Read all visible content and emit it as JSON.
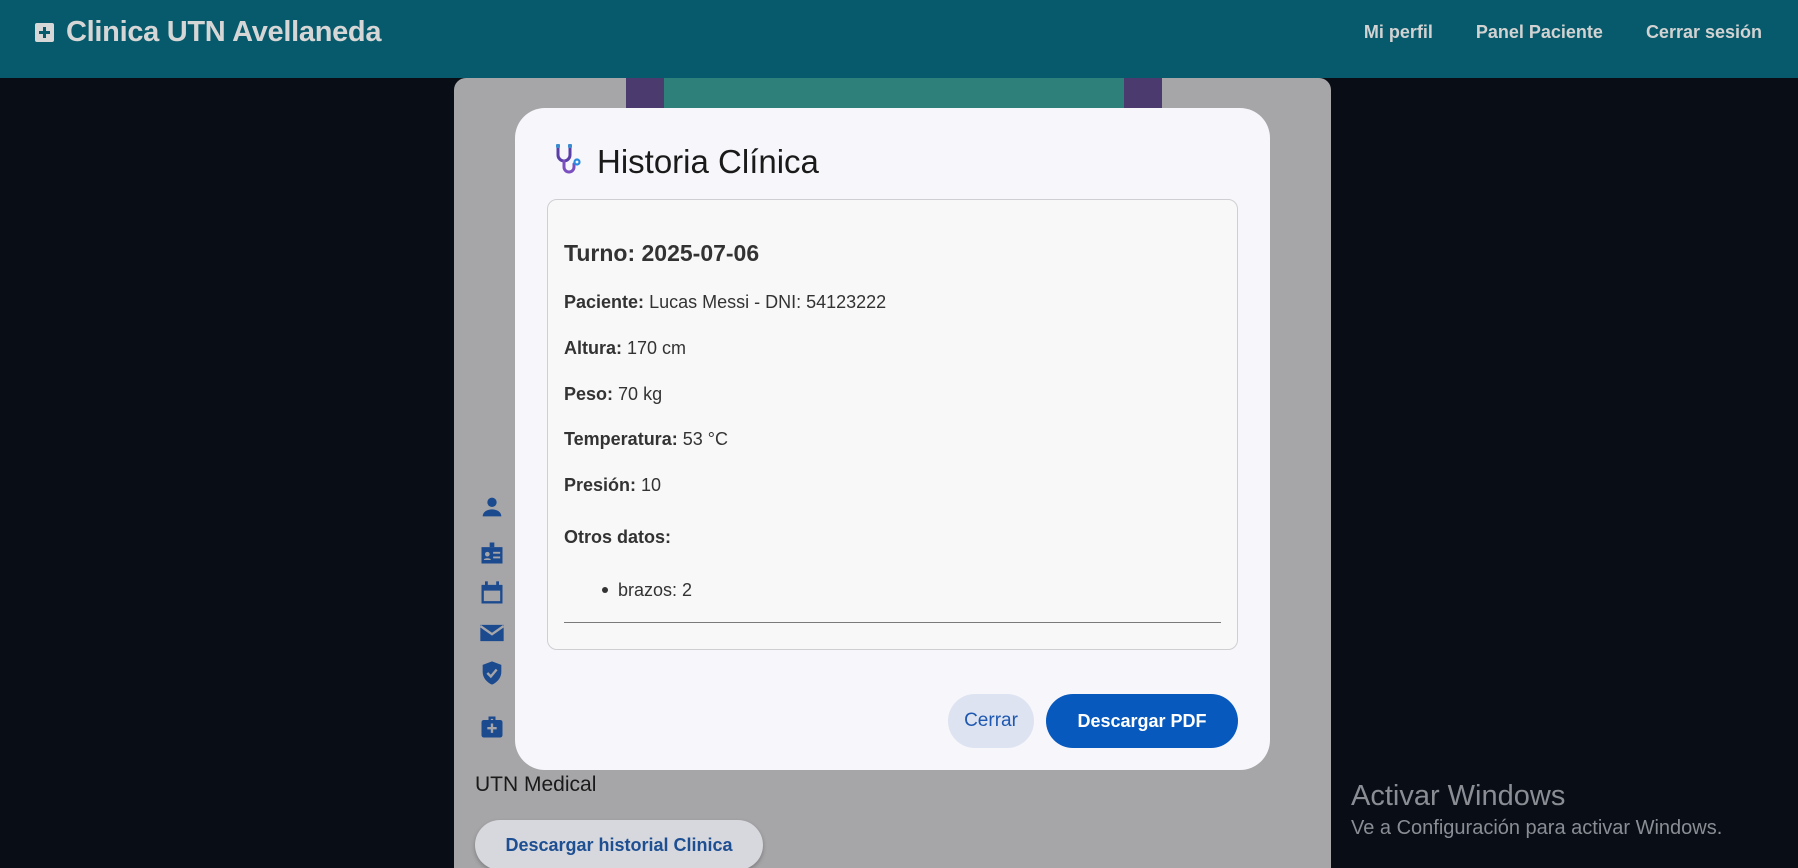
{
  "navbar": {
    "title": "Clinica UTN Avellaneda",
    "links": [
      "Mi perfil",
      "Panel Paciente",
      "Cerrar sesión"
    ]
  },
  "background": {
    "caption": "UTN Medical",
    "button_label": "Descargar historial Clinica",
    "icons": [
      "person-icon",
      "badge-icon",
      "calendar-icon",
      "mail-icon",
      "shield-check-icon",
      "medical-bag-icon"
    ]
  },
  "modal": {
    "title": "Historia Clínica",
    "turno": "Turno: 2025-07-06",
    "fields": [
      {
        "label": "Paciente:",
        "value": "Lucas Messi - DNI: 54123222"
      },
      {
        "label": "Altura:",
        "value": "170 cm"
      },
      {
        "label": "Peso:",
        "value": "70 kg"
      },
      {
        "label": "Temperatura:",
        "value": "53 °C"
      },
      {
        "label": "Presión:",
        "value": "10"
      }
    ],
    "otros_label": "Otros datos:",
    "otros": [
      "brazos: 2"
    ],
    "close_label": "Cerrar",
    "pdf_label": "Descargar PDF"
  },
  "watermark": {
    "title": "Activar Windows",
    "subtitle": "Ve a Configuración para activar Windows."
  },
  "colors": {
    "navbar": "#065a6b",
    "primary": "#0759be",
    "icon_blue": "#1c4a8f"
  }
}
